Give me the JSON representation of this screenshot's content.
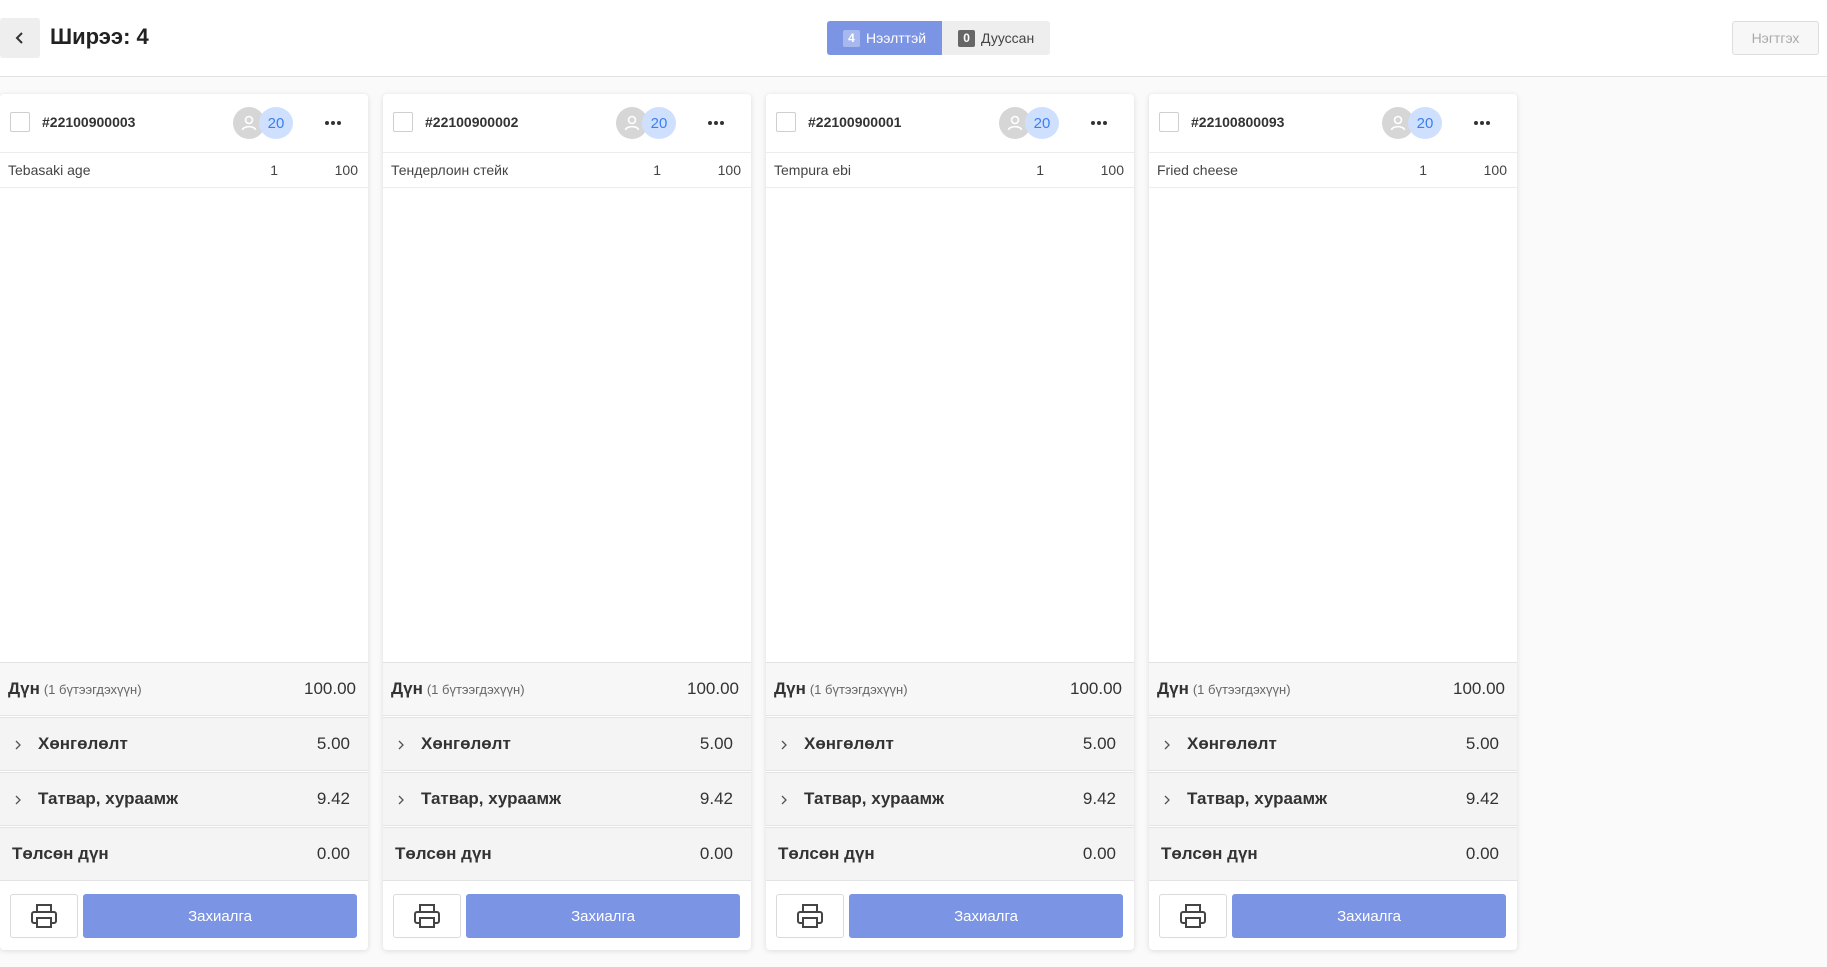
{
  "header": {
    "title": "Ширээ: 4",
    "tabs": [
      {
        "count": "4",
        "label": "Нээлттэй"
      },
      {
        "count": "0",
        "label": "Дууссан"
      }
    ],
    "join_label": "Нэгтгэх"
  },
  "cards": [
    {
      "order_id": "#22100900003",
      "guest_badge": "20",
      "item": {
        "name": "Tebasaki age",
        "qty": "1",
        "price": "100"
      },
      "total_label": "Дүн",
      "total_sub": "(1 бүтээгдэхүүн)",
      "total_value": "100.00",
      "discount_label": "Хөнгөлөлт",
      "discount_value": "5.00",
      "tax_label": "Татвар, хураамж",
      "tax_value": "9.42",
      "paid_label": "Төлсөн дүн",
      "paid_value": "0.00",
      "order_button": "Захиалга"
    },
    {
      "order_id": "#22100900002",
      "guest_badge": "20",
      "item": {
        "name": "Тендерлоин стейк",
        "qty": "1",
        "price": "100"
      },
      "total_label": "Дүн",
      "total_sub": "(1 бүтээгдэхүүн)",
      "total_value": "100.00",
      "discount_label": "Хөнгөлөлт",
      "discount_value": "5.00",
      "tax_label": "Татвар, хураамж",
      "tax_value": "9.42",
      "paid_label": "Төлсөн дүн",
      "paid_value": "0.00",
      "order_button": "Захиалга"
    },
    {
      "order_id": "#22100900001",
      "guest_badge": "20",
      "item": {
        "name": "Tempura ebi",
        "qty": "1",
        "price": "100"
      },
      "total_label": "Дүн",
      "total_sub": "(1 бүтээгдэхүүн)",
      "total_value": "100.00",
      "discount_label": "Хөнгөлөлт",
      "discount_value": "5.00",
      "tax_label": "Татвар, хураамж",
      "tax_value": "9.42",
      "paid_label": "Төлсөн дүн",
      "paid_value": "0.00",
      "order_button": "Захиалга"
    },
    {
      "order_id": "#22100800093",
      "guest_badge": "20",
      "item": {
        "name": "Fried cheese",
        "qty": "1",
        "price": "100"
      },
      "total_label": "Дүн",
      "total_sub": "(1 бүтээгдэхүүн)",
      "total_value": "100.00",
      "discount_label": "Хөнгөлөлт",
      "discount_value": "5.00",
      "tax_label": "Татвар, хураамж",
      "tax_value": "9.42",
      "paid_label": "Төлсөн дүн",
      "paid_value": "0.00",
      "order_button": "Захиалга"
    }
  ],
  "colors": {
    "accent": "#7b94e3",
    "badge_bg": "#cfe0ff",
    "badge_text": "#3b7ff0"
  }
}
